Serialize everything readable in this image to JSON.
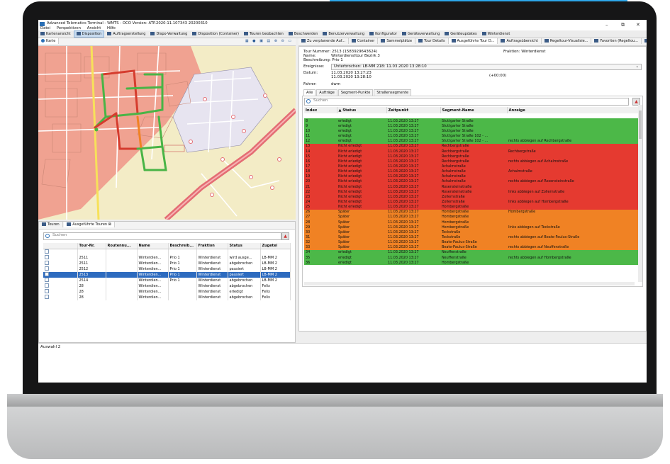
{
  "window": {
    "title": "Advanced Telematics Terminal - WMTS - OCO Version: ATP.2020-11.107343 20200310",
    "menu": [
      "Datei",
      "Perspektiven",
      "Ansicht",
      "Hilfe"
    ],
    "controls": [
      "–",
      "⧉",
      "✕"
    ]
  },
  "perspectives": [
    {
      "label": "Kartenansicht",
      "active": false
    },
    {
      "label": "Disposition",
      "active": true
    },
    {
      "label": "Auftragserstellung",
      "active": false
    },
    {
      "label": "Dispo-Verwaltung",
      "active": false
    },
    {
      "label": "Disposition (Container)",
      "active": false
    },
    {
      "label": "Touren beobachten",
      "active": false
    },
    {
      "label": "Beschwerden",
      "active": false
    },
    {
      "label": "Benutzerverwaltung",
      "active": false
    },
    {
      "label": "Konfigurator",
      "active": false
    },
    {
      "label": "Geräteverwaltung",
      "active": false
    },
    {
      "label": "Geräteupdates",
      "active": false
    },
    {
      "label": "Winterdienst",
      "active": false
    }
  ],
  "map_panel": {
    "tab": "Karte"
  },
  "right_tabs": [
    "Zu verplanende Auf...",
    "Container",
    "Sammelplätze",
    "Tour Details",
    "Ausgeführte Tour D...",
    "Auftragsübersicht",
    "Regeltour-Visualisie...",
    "Favoriten (Regeltou...",
    "Prozesse"
  ],
  "tour_info": {
    "tour_nummer_label": "Tour Nummer:",
    "tour_nummer": "2513 (1583929643624)",
    "fraktion_label": "Fraktion:",
    "fraktion": "Winterdienst",
    "name_label": "Name:",
    "name": "Winterdiensttour Bezirk 3",
    "beschreibung_label": "Beschreibung:",
    "beschreibung": "Prio 1",
    "ereignisse_label": "Ereignisse:",
    "ereignis": "Unterbrochen: LB-MM 218: 11.03.2020 13:28:10",
    "datum_label": "Datum:",
    "datum_von": "11.03.2020 13:27:23",
    "datum_bis": "11.03.2020 13:28:10",
    "dauer": "(+00:00)",
    "fahrer_label": "Fahrer:",
    "fahrer": "dwm"
  },
  "sub_tabs": [
    "Alle",
    "Aufträge",
    "Segment-Punkte",
    "Straßensegmente"
  ],
  "segment_search_placeholder": "Suchen",
  "segment_columns": [
    "Index",
    "▲ Status",
    "Zeitpunkt",
    "Segment-Name",
    "Anzeige"
  ],
  "segments": [
    {
      "i": "",
      "s": "",
      "t": "",
      "n": "",
      "a": "",
      "c": "w"
    },
    {
      "i": "8",
      "s": "erledigt",
      "t": "11.03.2020 13:27",
      "n": "Stuttgarter Straße",
      "a": "",
      "c": "g"
    },
    {
      "i": "9",
      "s": "erledigt",
      "t": "11.03.2020 13:27",
      "n": "Stuttgarter Straße",
      "a": "",
      "c": "g"
    },
    {
      "i": "10",
      "s": "erledigt",
      "t": "11.03.2020 13:27",
      "n": "Stuttgarter Straße",
      "a": "",
      "c": "g"
    },
    {
      "i": "11",
      "s": "erledigt",
      "t": "11.03.2020 13:27",
      "n": "Stuttgarter Straße 102 - ...",
      "a": "",
      "c": "g"
    },
    {
      "i": "12",
      "s": "erledigt",
      "t": "11.03.2020 13:27",
      "n": "Stuttgarter Straße 102 - ...",
      "a": "rechts abbiegen auf Rechbergstraße",
      "c": "g"
    },
    {
      "i": "13",
      "s": "Nicht erledigt",
      "t": "11.03.2020 13:27",
      "n": "Rechbergstraße",
      "a": "",
      "c": "r"
    },
    {
      "i": "14",
      "s": "Nicht erledigt",
      "t": "11.03.2020 13:27",
      "n": "Rechbergstraße",
      "a": "Rechbergstraße",
      "c": "r"
    },
    {
      "i": "15",
      "s": "Nicht erledigt",
      "t": "11.03.2020 13:27",
      "n": "Rechbergstraße",
      "a": "",
      "c": "r"
    },
    {
      "i": "16",
      "s": "Nicht erledigt",
      "t": "11.03.2020 13:27",
      "n": "Rechbergstraße",
      "a": "rechts abbiegen auf Achalmstraße",
      "c": "r"
    },
    {
      "i": "17",
      "s": "Nicht erledigt",
      "t": "11.03.2020 13:27",
      "n": "Achalmstraße",
      "a": "",
      "c": "r"
    },
    {
      "i": "18",
      "s": "Nicht erledigt",
      "t": "11.03.2020 13:27",
      "n": "Achalmstraße",
      "a": "Achalmstraße",
      "c": "r"
    },
    {
      "i": "19",
      "s": "Nicht erledigt",
      "t": "11.03.2020 13:27",
      "n": "Achalmstraße",
      "a": "",
      "c": "r"
    },
    {
      "i": "20",
      "s": "Nicht erledigt",
      "t": "11.03.2020 13:27",
      "n": "Achalmstraße",
      "a": "rechts abbiegen auf Rosensteinstraße",
      "c": "r"
    },
    {
      "i": "21",
      "s": "Nicht erledigt",
      "t": "11.03.2020 13:27",
      "n": "Rosensteinstraße",
      "a": "",
      "c": "r"
    },
    {
      "i": "22",
      "s": "Nicht erledigt",
      "t": "11.03.2020 13:27",
      "n": "Rosensteinstraße",
      "a": "links abbiegen auf Zollernstraße",
      "c": "r"
    },
    {
      "i": "23",
      "s": "Nicht erledigt",
      "t": "11.03.2020 13:27",
      "n": "Zollernstraße",
      "a": "",
      "c": "r"
    },
    {
      "i": "24",
      "s": "Nicht erledigt",
      "t": "11.03.2020 13:27",
      "n": "Zollernstraße",
      "a": "links abbiegen auf Hombergstraße",
      "c": "r"
    },
    {
      "i": "25",
      "s": "Nicht erledigt",
      "t": "11.03.2020 13:27",
      "n": "Hombergstraße",
      "a": "",
      "c": "r"
    },
    {
      "i": "26",
      "s": "Später",
      "t": "11.03.2020 13:27",
      "n": "Hombergstraße",
      "a": "Hombergstraße",
      "c": "o"
    },
    {
      "i": "27",
      "s": "Später",
      "t": "11.03.2020 13:27",
      "n": "Hombergstraße",
      "a": "",
      "c": "o"
    },
    {
      "i": "28",
      "s": "Später",
      "t": "11.03.2020 13:27",
      "n": "Hombergstraße",
      "a": "",
      "c": "o"
    },
    {
      "i": "29",
      "s": "Später",
      "t": "11.03.2020 13:27",
      "n": "Hombergstraße",
      "a": "links abbiegen auf Teckstraße",
      "c": "o"
    },
    {
      "i": "30",
      "s": "Später",
      "t": "11.03.2020 13:27",
      "n": "Teckstraße",
      "a": "",
      "c": "o"
    },
    {
      "i": "31",
      "s": "Später",
      "t": "11.03.2020 13:27",
      "n": "Teckstraße",
      "a": "rechts abbiegen auf Beate-Paulus-Straße",
      "c": "o"
    },
    {
      "i": "32",
      "s": "Später",
      "t": "11.03.2020 13:27",
      "n": "Beate-Paulus-Straße",
      "a": "",
      "c": "o"
    },
    {
      "i": "33",
      "s": "Später",
      "t": "11.03.2020 13:27",
      "n": "Beate-Paulus-Straße",
      "a": "rechts abbiegen auf Neuffenstraße",
      "c": "o"
    },
    {
      "i": "34",
      "s": "erledigt",
      "t": "11.03.2020 13:27",
      "n": "Neuffenstraße",
      "a": "",
      "c": "g"
    },
    {
      "i": "35",
      "s": "erledigt",
      "t": "11.03.2020 13:27",
      "n": "Neuffenstraße",
      "a": "rechts abbiegen auf Hombergstraße",
      "c": "g"
    },
    {
      "i": "36",
      "s": "erledigt",
      "t": "11.03.2020 13:27",
      "n": "Hombergstraße",
      "a": "",
      "c": "g"
    }
  ],
  "tours_panel": {
    "tabs": [
      "Touren",
      "Ausgeführte Touren"
    ],
    "search_placeholder": "Suchen",
    "columns": [
      "",
      "Tour-Nr.",
      "Routennu...",
      "Name",
      "Beschreib...",
      "Fraktion",
      "Status",
      "Zugetei"
    ],
    "rows": [
      {
        "nr": "",
        "route": "",
        "name": "",
        "desc": "",
        "fraktion": "",
        "status": "",
        "zug": "",
        "sel": false
      },
      {
        "nr": "2511",
        "route": "",
        "name": "Winterdien...",
        "desc": "Prio 1",
        "fraktion": "Winterdienst",
        "status": "wird ausge...",
        "zug": "LB-MM 2",
        "sel": false
      },
      {
        "nr": "2511",
        "route": "",
        "name": "Winterdien...",
        "desc": "Prio 1",
        "fraktion": "Winterdienst",
        "status": "abgebrochen",
        "zug": "LB-MM 2",
        "sel": false
      },
      {
        "nr": "2512",
        "route": "",
        "name": "Winterdien...",
        "desc": "Prio 1",
        "fraktion": "Winterdienst",
        "status": "pausiert",
        "zug": "LB-MM 2",
        "sel": false
      },
      {
        "nr": "2513",
        "route": "",
        "name": "Winterdien...",
        "desc": "Prio 1",
        "fraktion": "Winterdienst",
        "status": "pausiert",
        "zug": "LB-MM 2",
        "sel": true
      },
      {
        "nr": "2514",
        "route": "",
        "name": "Winterdien...",
        "desc": "Prio 1",
        "fraktion": "Winterdienst",
        "status": "abgebrochen",
        "zug": "LB-MM 2",
        "sel": false
      },
      {
        "nr": "28",
        "route": "",
        "name": "Winterdien...",
        "desc": "",
        "fraktion": "Winterdienst",
        "status": "abgebrochen",
        "zug": "Felix",
        "sel": false
      },
      {
        "nr": "28",
        "route": "",
        "name": "Winterdien...",
        "desc": "",
        "fraktion": "Winterdienst",
        "status": "erledigt",
        "zug": "Felix",
        "sel": false
      },
      {
        "nr": "28",
        "route": "",
        "name": "Winterdien...",
        "desc": "",
        "fraktion": "Winterdienst",
        "status": "abgebrochen",
        "zug": "Felix",
        "sel": false
      }
    ]
  },
  "status_bar": "Auswahl 2",
  "colors": {
    "green": "#4cb848",
    "red": "#e53a30",
    "orange": "#f08224",
    "selection": "#2d6bbf",
    "accent_blue": "#2da6e8"
  }
}
